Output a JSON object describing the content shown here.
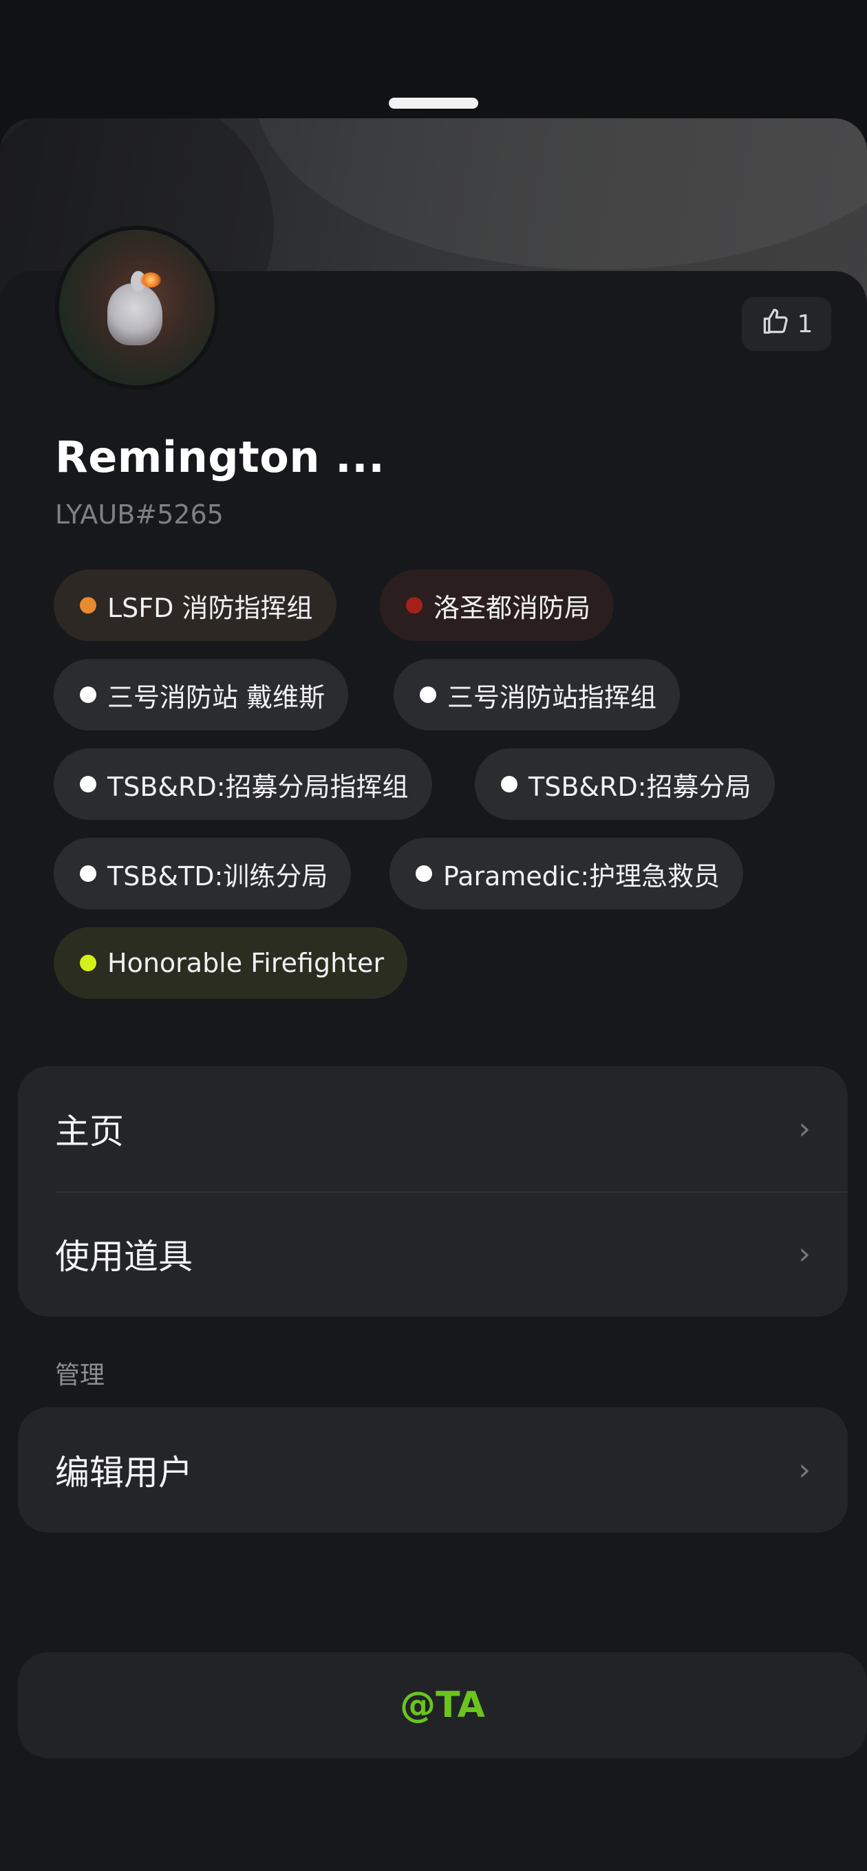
{
  "profile": {
    "name": "Remington ...",
    "user_id": "LYAUB#5265",
    "like_count": "1"
  },
  "tags": [
    {
      "label": "LSFD 消防指挥组",
      "dot_color": "#e88a30",
      "bg_color": "#2e2824"
    },
    {
      "label": "洛圣都消防局",
      "dot_color": "#a5201a",
      "bg_color": "#2a1e1e"
    },
    {
      "label": "三号消防站 戴维斯",
      "dot_color": "#ffffff",
      "bg_color": "#2b2c30"
    },
    {
      "label": "三号消防站指挥组",
      "dot_color": "#ffffff",
      "bg_color": "#2b2c30"
    },
    {
      "label": "TSB&RD:招募分局指挥组",
      "dot_color": "#ffffff",
      "bg_color": "#2b2c30"
    },
    {
      "label": "TSB&RD:招募分局",
      "dot_color": "#ffffff",
      "bg_color": "#2b2c30"
    },
    {
      "label": "TSB&TD:训练分局",
      "dot_color": "#ffffff",
      "bg_color": "#2b2c30"
    },
    {
      "label": "Paramedic:护理急救员",
      "dot_color": "#ffffff",
      "bg_color": "#2b2c30"
    },
    {
      "label": "Honorable Firefighter",
      "dot_color": "#d4f21a",
      "bg_color": "#2a2d20"
    }
  ],
  "menu": {
    "items": [
      {
        "label": "主页",
        "chevron": "›"
      },
      {
        "label": "使用道具",
        "chevron": "›"
      }
    ]
  },
  "admin": {
    "title": "管理",
    "items": [
      {
        "label": "编辑用户",
        "chevron": "›"
      }
    ]
  },
  "mention_button": {
    "label": "@TA",
    "color": "#6cc41e"
  },
  "icons": {
    "like": "thumbs-up-icon",
    "chevron": "chevron-right-icon"
  }
}
